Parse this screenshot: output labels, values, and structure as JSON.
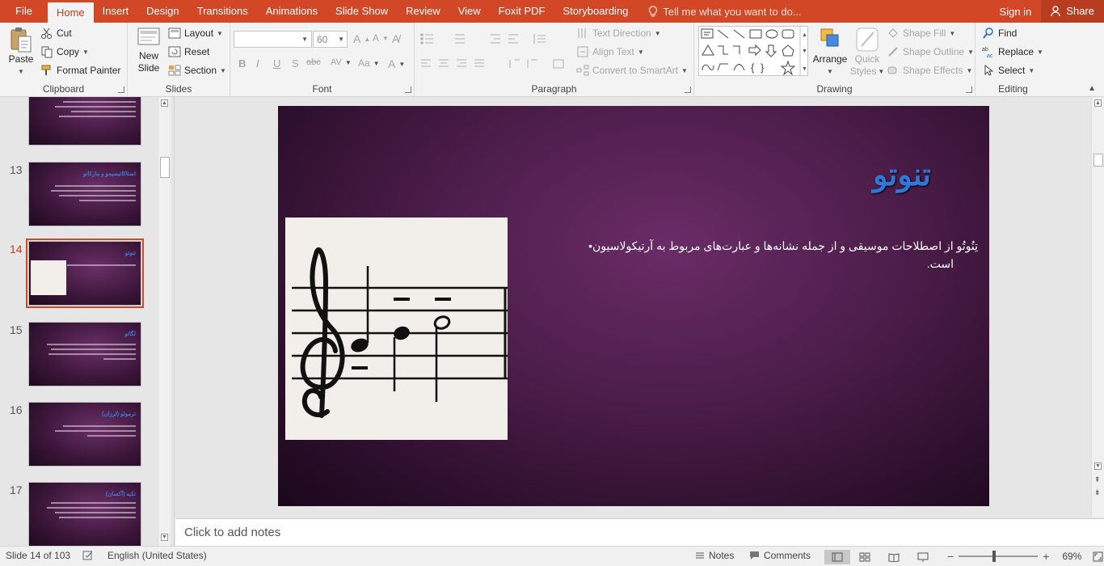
{
  "tabs": {
    "file": "File",
    "home": "Home",
    "insert": "Insert",
    "design": "Design",
    "transitions": "Transitions",
    "animations": "Animations",
    "slide_show": "Slide Show",
    "review": "Review",
    "view": "View",
    "foxit": "Foxit PDF",
    "storyboarding": "Storyboarding"
  },
  "tell_me": "Tell me what you want to do...",
  "sign_in": "Sign in",
  "share": "Share",
  "clipboard": {
    "label": "Clipboard",
    "paste": "Paste",
    "cut": "Cut",
    "copy": "Copy",
    "format_painter": "Format Painter"
  },
  "slides_group": {
    "label": "Slides",
    "new_slide_1": "New",
    "new_slide_2": "Slide",
    "layout": "Layout",
    "reset": "Reset",
    "section": "Section"
  },
  "font": {
    "label": "Font",
    "size": "60",
    "bold": "B",
    "italic": "I",
    "underline": "U",
    "shadow": "S",
    "strike": "abc",
    "spacing": "AV",
    "case": "Aa",
    "color": "A"
  },
  "paragraph": {
    "label": "Paragraph",
    "text_direction": "Text Direction",
    "align_text": "Align Text",
    "smartart": "Convert to SmartArt"
  },
  "drawing": {
    "label": "Drawing",
    "arrange": "Arrange",
    "quick_styles_1": "Quick",
    "quick_styles_2": "Styles",
    "shape_fill": "Shape Fill",
    "shape_outline": "Shape Outline",
    "shape_effects": "Shape Effects"
  },
  "editing": {
    "label": "Editing",
    "find": "Find",
    "replace": "Replace",
    "select": "Select"
  },
  "thumbnails": [
    {
      "num": "13",
      "title": "استاکاتیسیمو و مارکاتو"
    },
    {
      "num": "14",
      "title": "تنوتو"
    },
    {
      "num": "15",
      "title": "لگاتو"
    },
    {
      "num": "16",
      "title": "ترمولو (لرزان)"
    },
    {
      "num": "17",
      "title": "تکیه (آکسان)"
    }
  ],
  "slide": {
    "title": "تنوتو",
    "body_line1": "تِنُوتُو از اصطلاحات موسیقی و از جمله نشانه‌ها و عبارت‌های مربوط به آرتیکولاسیون",
    "body_line2": "است."
  },
  "notes_placeholder": "Click to add notes",
  "status": {
    "slide_of": "Slide 14 of 103",
    "language": "English (United States)",
    "notes": "Notes",
    "comments": "Comments",
    "zoom": "69%"
  },
  "colors": {
    "accent": "#d24726",
    "title_blue": "#2e78d8"
  }
}
